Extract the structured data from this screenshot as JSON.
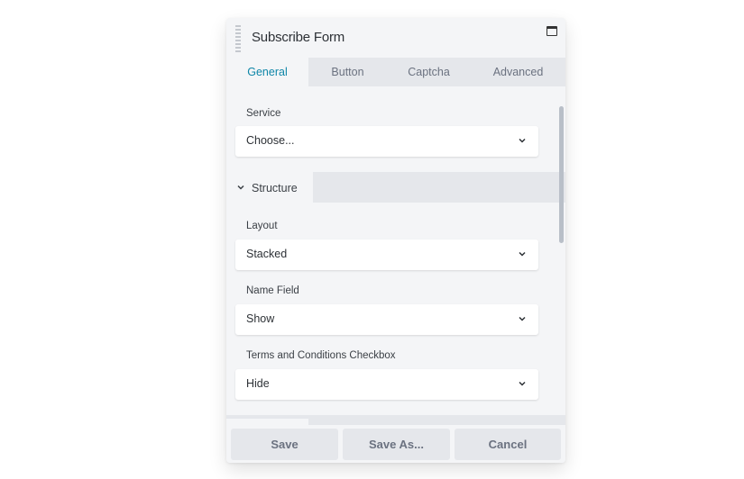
{
  "panel": {
    "title": "Subscribe Form",
    "icons": {
      "drag": "drag-handle-icon",
      "maximize": "maximize-icon"
    }
  },
  "tabs": [
    {
      "label": "General",
      "active": true
    },
    {
      "label": "Button",
      "active": false
    },
    {
      "label": "Captcha",
      "active": false
    },
    {
      "label": "Advanced",
      "active": false
    }
  ],
  "fields": {
    "service": {
      "label": "Service",
      "value": "Choose..."
    },
    "structure_section": {
      "label": "Structure",
      "expanded": true
    },
    "layout": {
      "label": "Layout",
      "value": "Stacked"
    },
    "name_field": {
      "label": "Name Field",
      "value": "Show"
    },
    "terms_checkbox": {
      "label": "Terms and Conditions Checkbox",
      "value": "Hide"
    }
  },
  "footer": {
    "save_label": "Save",
    "save_as_label": "Save As...",
    "cancel_label": "Cancel"
  },
  "colors": {
    "accent": "#0e86a8",
    "panel_bg": "#f4f5f7",
    "tab_bg": "#e5e7eb"
  }
}
